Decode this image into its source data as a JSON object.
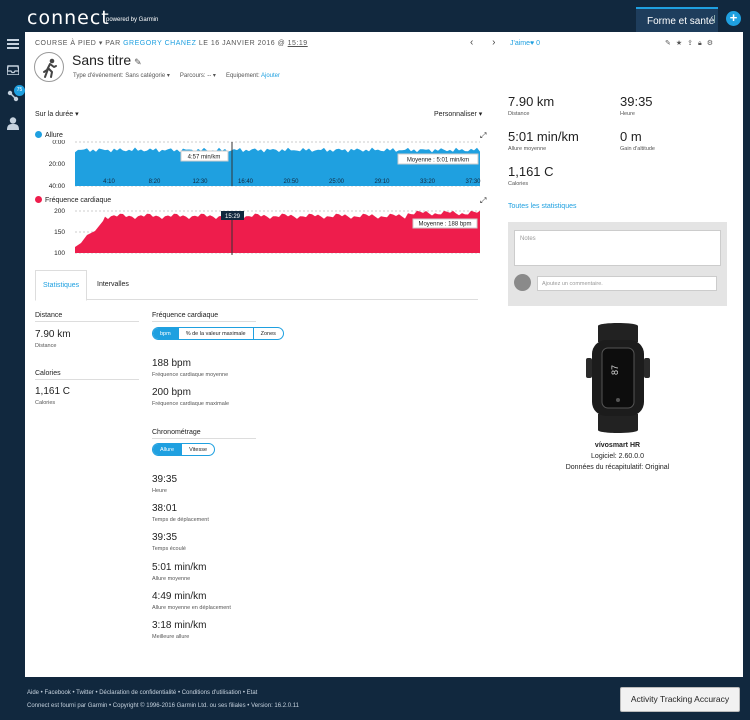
{
  "header": {
    "logo": "connect",
    "logo_sub": "powered by Garmin",
    "active_tab": "Forme et santé",
    "plus_label": "+"
  },
  "nav": {
    "badge_count": "75"
  },
  "activity": {
    "type_label": "COURSE À PIED",
    "by_prefix": "PAR",
    "author": "GREGORY CHANEZ",
    "date_prefix": "LE 16 JANVIER 2016 @",
    "time": "15:19",
    "prev_arrow": "‹",
    "next_arrow": "›",
    "title": "Sans titre",
    "event_type_label": "Type d'événement:",
    "event_type_value": "Sans catégorie",
    "route_label": "Parcours:",
    "route_value": "--",
    "equipment_label": "Equipement:",
    "equipment_add": "Ajouter"
  },
  "charts": {
    "range_select": "Sur la durée",
    "customize": "Personnaliser",
    "pace_label": "Allure",
    "pace_color": "#1fa0e0",
    "pace_y_ticks": [
      "0:00",
      "20:00",
      "40:00"
    ],
    "pace_x_ticks": [
      "4:10",
      "8:20",
      "12:30",
      "16:40",
      "20:50",
      "25:00",
      "29:10",
      "33:20",
      "37:30"
    ],
    "pace_cursor_value": "4:57 min/km",
    "pace_avg_label": "Moyenne : 5:01 min/km",
    "hr_label": "Fréquence cardiaque",
    "hr_color": "#ee1d4c",
    "hr_y_ticks": [
      "200",
      "150",
      "100"
    ],
    "hr_cursor_time": "15:29",
    "hr_avg_label": "Moyenne : 188 bpm"
  },
  "tabs": [
    "Statistiques",
    "Intervalles"
  ],
  "stats": {
    "distance_head": "Distance",
    "distance_value": "7.90 km",
    "distance_label": "Distance",
    "calories_head": "Calories",
    "calories_value": "1,161 C",
    "calories_label": "Calories",
    "hr_head": "Fréquence cardiaque",
    "hr_seg": [
      "bpm",
      "% de la valeur maximale",
      "Zones"
    ],
    "hr_avg_value": "188 bpm",
    "hr_avg_label": "Fréquence cardiaque moyenne",
    "hr_max_value": "200 bpm",
    "hr_max_label": "Fréquence cardiaque maximale",
    "timing_head": "Chronométrage",
    "timing_seg": [
      "Allure",
      "Vitesse"
    ],
    "timing": [
      {
        "value": "39:35",
        "label": "Heure"
      },
      {
        "value": "38:01",
        "label": "Temps de déplacement"
      },
      {
        "value": "39:35",
        "label": "Temps écoulé"
      },
      {
        "value": "5:01 min/km",
        "label": "Allure moyenne"
      },
      {
        "value": "4:49 min/km",
        "label": "Allure moyenne en déplacement"
      },
      {
        "value": "3:18 min/km",
        "label": "Meilleure allure"
      }
    ]
  },
  "right": {
    "like_label": "J'aime",
    "like_count": "0",
    "summary": [
      {
        "value": "7.90 km",
        "label": "Distance"
      },
      {
        "value": "39:35",
        "label": "Heure"
      },
      {
        "value": "5:01 min/km",
        "label": "Allure moyenne"
      },
      {
        "value": "0 m",
        "label": "Gain d'altitude"
      },
      {
        "value": "1,161 C",
        "label": "Calories"
      }
    ],
    "all_stats": "Toutes les statistiques",
    "notes_placeholder": "Notes",
    "comment_placeholder": "Ajoutez un commentaire.",
    "device_name": "vívosmart HR",
    "device_software": "Logiciel: 2.60.0.0",
    "device_summary": "Données du récapitulatif: Original"
  },
  "footer": {
    "links": "Aide • Facebook • Twitter • Déclaration de confidentialité • Conditions d'utilisation • Etat",
    "copyright": "Connect est fourni par Garmin • Copyright © 1996-2016 Garmin Ltd. ou ses filiales • Version: 16.2.0.11",
    "ata_button": "Activity Tracking Accuracy"
  }
}
